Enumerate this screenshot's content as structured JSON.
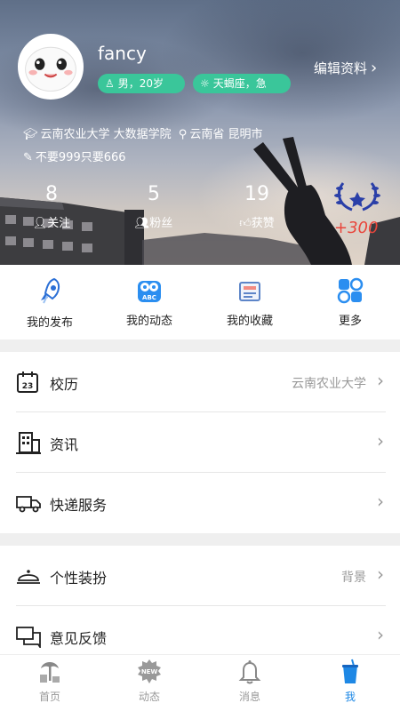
{
  "profile": {
    "username": "fancy",
    "gender_age": "男，20岁",
    "zodiac": "天蝎座，急",
    "edit_label": "编辑资料",
    "school": "云南农业大学 大数据学院",
    "location": "云南省 昆明市",
    "motto": "不要999只要666",
    "badge_points": "+300"
  },
  "stats": [
    {
      "value": "8",
      "label": "关注"
    },
    {
      "value": "5",
      "label": "粉丝"
    },
    {
      "value": "19",
      "label": "获赞"
    }
  ],
  "quick_actions": [
    {
      "label": "我的发布",
      "icon": "rocket-icon"
    },
    {
      "label": "我的动态",
      "icon": "owl-abc-icon"
    },
    {
      "label": "我的收藏",
      "icon": "box-icon"
    },
    {
      "label": "更多",
      "icon": "apps-icon"
    }
  ],
  "menu1": [
    {
      "label": "校历",
      "value": "云南农业大学",
      "icon": "calendar-icon"
    },
    {
      "label": "资讯",
      "value": "",
      "icon": "building-icon"
    },
    {
      "label": "快递服务",
      "value": "",
      "icon": "truck-icon"
    }
  ],
  "menu2": [
    {
      "label": "个性装扮",
      "value": "背景",
      "icon": "cloche-icon"
    },
    {
      "label": "意见反馈",
      "value": "",
      "icon": "chat-icon"
    }
  ],
  "tabs": [
    {
      "label": "首页",
      "icon": "home-palm-icon",
      "active": false
    },
    {
      "label": "动态",
      "icon": "new-badge-icon",
      "active": false
    },
    {
      "label": "消息",
      "icon": "bell-icon",
      "active": false
    },
    {
      "label": "我",
      "icon": "cup-icon",
      "active": true
    }
  ],
  "colors": {
    "accent": "#1e88e5",
    "tag_green": "#3ac69a",
    "points_red": "#e9453b"
  }
}
